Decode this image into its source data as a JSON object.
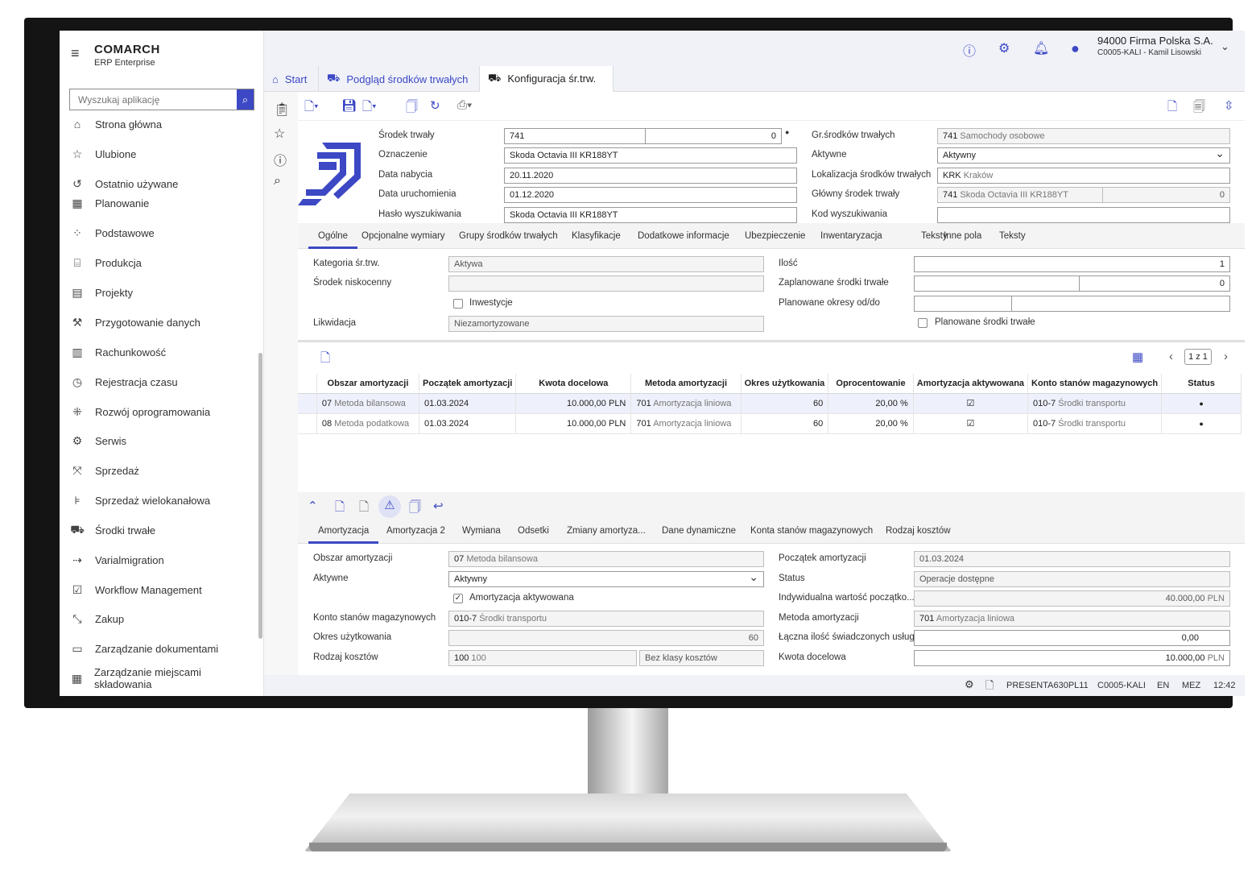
{
  "app": {
    "brand": "COMARCH",
    "subtitle": "ERP Enterprise"
  },
  "search": {
    "placeholder": "Wyszukaj aplikację"
  },
  "nav": {
    "items": [
      {
        "label": "Strona główna",
        "icon": "home-icon"
      },
      {
        "label": "Ulubione",
        "icon": "star-icon"
      },
      {
        "label": "Ostatnio używane",
        "icon": "history-icon"
      },
      {
        "label": "Planowanie",
        "icon": "calendar-icon"
      },
      {
        "label": "Podstawowe",
        "icon": "grid-icon"
      },
      {
        "label": "Produkcja",
        "icon": "factory-icon"
      },
      {
        "label": "Projekty",
        "icon": "project-icon"
      },
      {
        "label": "Przygotowanie danych",
        "icon": "tools-icon"
      },
      {
        "label": "Rachunkowość",
        "icon": "accounting-icon"
      },
      {
        "label": "Rejestracja czasu",
        "icon": "clock-icon"
      },
      {
        "label": "Rozwój oprogramowania",
        "icon": "dev-icon"
      },
      {
        "label": "Serwis",
        "icon": "gears-icon"
      },
      {
        "label": "Sprzedaż",
        "icon": "expand-icon"
      },
      {
        "label": "Sprzedaż wielokanałowa",
        "icon": "channel-icon"
      },
      {
        "label": "Środki trwałe",
        "icon": "asset-icon"
      },
      {
        "label": "Varialmigration",
        "icon": "migration-icon"
      },
      {
        "label": "Workflow Management",
        "icon": "workflow-icon"
      },
      {
        "label": "Zakup",
        "icon": "collapse-icon"
      },
      {
        "label": "Zarządzanie dokumentami",
        "icon": "folder-icon"
      },
      {
        "label": "Zarządzanie miejscami składowania",
        "icon": "storage-icon"
      }
    ]
  },
  "header": {
    "company": "94000  Firma Polska S.A.",
    "user": "C0005-KALI - Kamil Lisowski"
  },
  "tabs": [
    {
      "label": "Start"
    },
    {
      "label": "Podgląd środków trwałych"
    },
    {
      "label": "Konfiguracja śr.trw."
    }
  ],
  "form": {
    "srodek_label": "Środek trwały",
    "srodek_value": "741",
    "srodek_num": "0",
    "oznaczenie_label": "Oznaczenie",
    "oznaczenie_value": "Skoda Octavia III KR188YT",
    "data_nabycia_label": "Data nabycia",
    "data_nabycia_value": "20.11.2020",
    "data_uruch_label": "Data uruchomienia",
    "data_uruch_value": "01.12.2020",
    "haslo_label": "Hasło wyszukiwania",
    "haslo_value": "Skoda Octavia III KR188YT",
    "gr_label": "Gr.środków trwałych",
    "gr_code": "741",
    "gr_desc": "Samochody osobowe",
    "aktywne_label": "Aktywne",
    "aktywne_value": "Aktywny",
    "lok_label": "Lokalizacja środków trwałych",
    "lok_code": "KRK",
    "lok_desc": "Kraków",
    "glowny_label": "Główny środek trwały",
    "glowny_code": "741",
    "glowny_desc": "Skoda Octavia III KR188YT",
    "glowny_num": "0",
    "kod_label": "Kod wyszukiwania",
    "kod_value": ""
  },
  "tabs2": [
    "Ogólne",
    "Opcjonalne wymiary",
    "Grupy środków trwałych",
    "Klasyfikacje",
    "Dodatkowe informacje",
    "Ubezpieczenie",
    "Inwentaryzacja",
    "Teksty",
    "Inne pola",
    "Teksty"
  ],
  "general": {
    "kat_label": "Kategoria śr.trw.",
    "kat_value": "Aktywa",
    "nisko_label": "Środek niskocenny",
    "nisko_value": "",
    "inwest_label": "Inwestycje",
    "likw_label": "Likwidacja",
    "likw_value": "Niezamortyzowane",
    "ilosc_label": "Ilość",
    "ilosc_value": "1",
    "zapl_label": "Zaplanowane środki trwałe",
    "zapl_value": "0",
    "plan_okresy_label": "Planowane okresy od/do",
    "plan_srodki_label": "Planowane środki trwałe"
  },
  "grid": {
    "pager": "1 z 1",
    "columns": [
      "Obszar amortyzacji",
      "Początek amortyzacji",
      "Kwota docelowa",
      "Metoda amortyzacji",
      "Okres użytkowania",
      "Oprocentowanie",
      "Amortyzacja aktywowana",
      "Konto stanów magazynowych",
      "Status"
    ],
    "rows": [
      {
        "obszar_code": "07",
        "obszar_desc": "Metoda bilansowa",
        "poczatek": "01.03.2024",
        "kwota": "10.000,00 PLN",
        "metoda_code": "701",
        "metoda_desc": "Amortyzacja liniowa",
        "okres": "60",
        "oproc": "20,00 %",
        "aktyw": "☑",
        "konto_code": "010-7",
        "konto_desc": "Środki transportu",
        "status": "●"
      },
      {
        "obszar_code": "08",
        "obszar_desc": "Metoda podatkowa",
        "poczatek": "01.03.2024",
        "kwota": "10.000,00 PLN",
        "metoda_code": "701",
        "metoda_desc": "Amortyzacja liniowa",
        "okres": "60",
        "oproc": "20,00 %",
        "aktyw": "☑",
        "konto_code": "010-7",
        "konto_desc": "Środki transportu",
        "status": "●"
      }
    ]
  },
  "tabs3": [
    "Amortyzacja",
    "Amortyzacja 2",
    "Wymiana",
    "Odsetki",
    "Zmiany amortyza...",
    "Dane dynamiczne",
    "Konta stanów magazynowych",
    "Rodzaj kosztów"
  ],
  "detail": {
    "obszar_label": "Obszar amortyzacji",
    "obszar_code": "07",
    "obszar_desc": "Metoda bilansowa",
    "aktywne_label": "Aktywne",
    "aktywne_value": "Aktywny",
    "amort_akt_label": "Amortyzacja aktywowana",
    "konto_label": "Konto stanów magazynowych",
    "konto_code": "010-7",
    "konto_desc": "Środki transportu",
    "okres_label": "Okres użytkowania",
    "okres_value": "60",
    "rodzaj_label": "Rodzaj kosztów",
    "rodzaj_code": "100",
    "rodzaj_desc": "100",
    "rodzaj_klasa": "Bez klasy kosztów",
    "poczatek_label": "Początek amortyzacji",
    "poczatek_value": "01.03.2024",
    "status_label": "Status",
    "status_value": "Operacje dostępne",
    "indyw_label": "Indywidualna wartość początko...",
    "indyw_value": "40.000,00",
    "indyw_cur": "PLN",
    "metoda_label": "Metoda amortyzacji",
    "metoda_code": "701",
    "metoda_desc": "Amortyzacja liniowa",
    "laczna_label": "Łączna ilość świadczonych usług",
    "laczna_value": "0,00",
    "kwota_label": "Kwota docelowa",
    "kwota_value": "10.000,00",
    "kwota_cur": "PLN"
  },
  "status": {
    "server": "PRESENTA630PL11",
    "user": "C0005-KALI",
    "lang": "EN",
    "tz": "MEZ",
    "time": "12:42"
  },
  "colors": {
    "accent": "#3c48c4",
    "header_bg": "#f0f2f8"
  }
}
